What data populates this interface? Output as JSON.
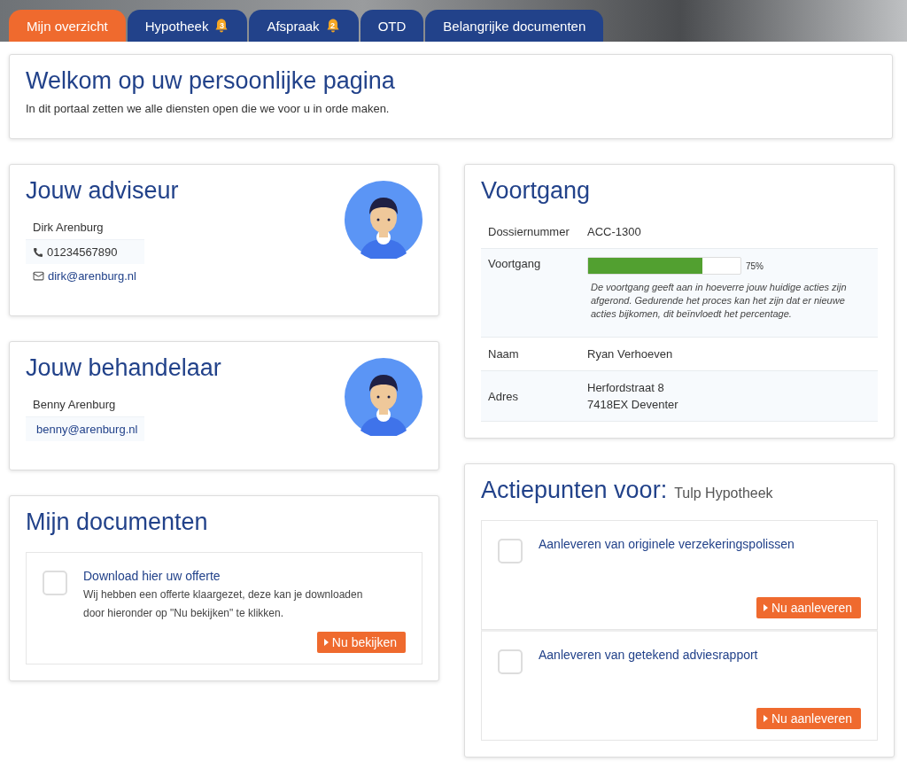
{
  "tabs": [
    {
      "label": "Mijn overzicht",
      "selected": true
    },
    {
      "label": "Hypotheek",
      "badge": "3",
      "selected": false
    },
    {
      "label": "Afspraak",
      "badge": "2",
      "selected": false
    },
    {
      "label": "OTD",
      "selected": false
    },
    {
      "label": "Belangrijke documenten",
      "selected": false
    }
  ],
  "welcome": {
    "title": "Welkom op uw persoonlijke pagina",
    "text": "In dit portaal zetten we alle diensten open die we voor u in orde maken."
  },
  "advisor": {
    "title": "Jouw adviseur",
    "rows": [
      {
        "kind": "name",
        "text": "Dirk Arenburg"
      },
      {
        "kind": "phone",
        "text": "01234567890"
      },
      {
        "kind": "email",
        "text": "dirk@arenburg.nl"
      }
    ]
  },
  "handler": {
    "title": "Jouw behandelaar",
    "rows": [
      {
        "kind": "name",
        "text": "Benny Arenburg"
      },
      {
        "kind": "email",
        "text": "benny@arenburg.nl"
      }
    ]
  },
  "documents": {
    "title": "Mijn documenten",
    "items": [
      {
        "title": "Download hier uw offerte",
        "description": "Wij hebben een offerte klaargezet, deze kan je downloaden door hieronder op \"Nu bekijken\" te klikken.",
        "checked": false,
        "button": "Nu bekijken"
      }
    ]
  },
  "progress": {
    "title": "Voortgang",
    "rows": [
      {
        "kind": "text",
        "label": "Dossiernummer",
        "value": "ACC-1300"
      },
      {
        "kind": "progress",
        "label": "Voortgang",
        "level": 0.75,
        "reading": "75%",
        "note": "De voortgang geeft aan in hoeverre jouw huidige acties zijn afgerond. Gedurende het proces kan het zijn dat er nieuwe acties bijkomen, dit beïnvloedt het percentage."
      },
      {
        "kind": "text",
        "label": "Naam",
        "value": "Ryan Verhoeven"
      },
      {
        "kind": "lines",
        "label": "Adres",
        "lines": [
          "Herfordstraat 8",
          "7418EX Deventer"
        ]
      }
    ]
  },
  "actions": {
    "title": "Actiepunten voor:",
    "subtitle": "Tulp Hypotheek",
    "items": [
      {
        "title": "Aanleveren van originele verzekeringspolissen",
        "checked": false,
        "button": "Nu aanleveren"
      },
      {
        "title": "Aanleveren van getekend adviesrapport",
        "checked": false,
        "button": "Nu aanleveren"
      }
    ]
  }
}
